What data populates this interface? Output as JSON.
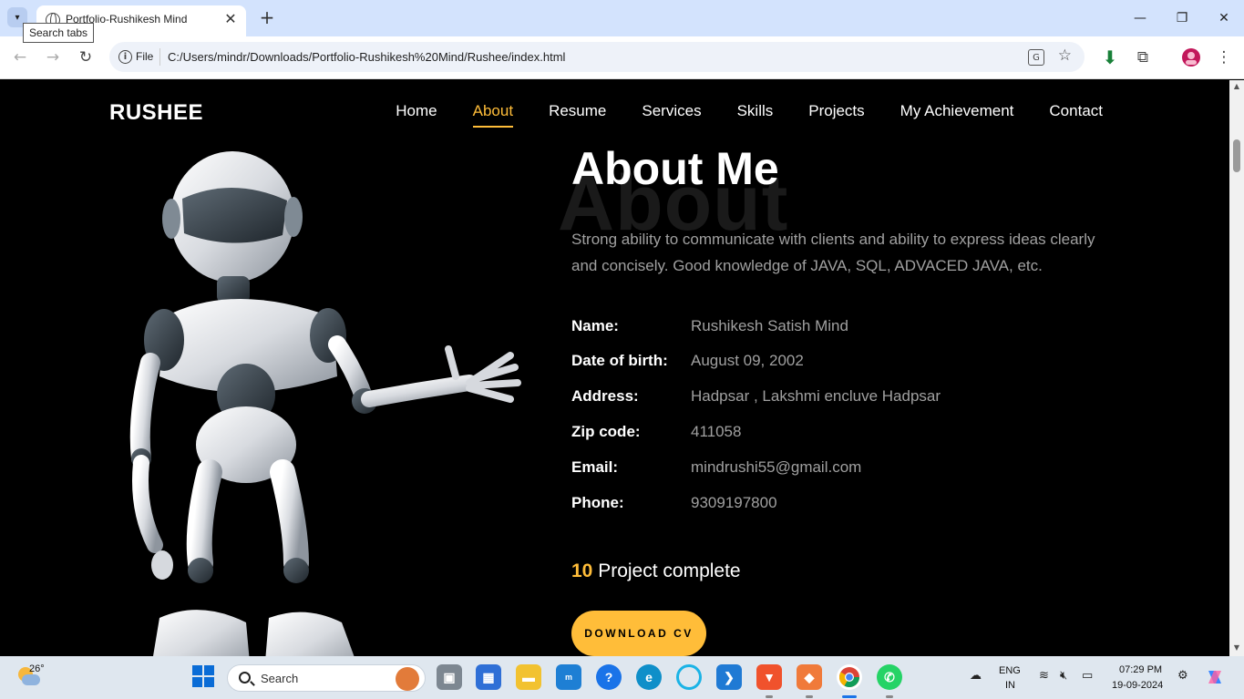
{
  "browser": {
    "tab_title": "Portfolio-Rushikesh Mind",
    "tooltip": "Search tabs",
    "scheme_label": "File",
    "url": "C:/Users/mindr/Downloads/Portfolio-Rushikesh%20Mind/Rushee/index.html"
  },
  "site": {
    "logo": "RUSHEE",
    "nav": [
      "Home",
      "About",
      "Resume",
      "Services",
      "Skills",
      "Projects",
      "My Achievement",
      "Contact"
    ],
    "active_nav": "About"
  },
  "about": {
    "background_word": "About",
    "heading": "About Me",
    "description": "Strong ability to communicate with clients and ability to express ideas clearly and concisely. Good knowledge of JAVA, SQL, ADVACED JAVA, etc.",
    "details": [
      {
        "label": "Name:",
        "value": "Rushikesh Satish Mind"
      },
      {
        "label": "Date of birth:",
        "value": "August 09, 2002"
      },
      {
        "label": "Address:",
        "value": "Hadpsar , Lakshmi encluve Hadpsar"
      },
      {
        "label": "Zip code:",
        "value": "411058"
      },
      {
        "label": "Email:",
        "value": "mindrushi55@gmail.com"
      },
      {
        "label": "Phone:",
        "value": "9309197800"
      }
    ],
    "project_count": "10",
    "project_label": "Project complete",
    "download_button": "DOWNLOAD CV"
  },
  "taskbar": {
    "temperature": "26°",
    "search_placeholder": "Search",
    "language_line1": "ENG",
    "language_line2": "IN",
    "time": "07:29 PM",
    "date": "19-09-2024"
  },
  "colors": {
    "accent": "#ffbd39",
    "page_bg": "#000000",
    "muted_text": "#a0a0a0"
  }
}
